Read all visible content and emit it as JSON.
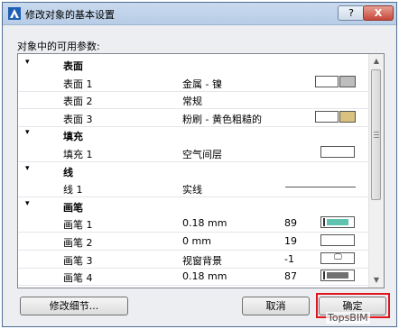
{
  "window": {
    "title": "修改对象的基本设置",
    "help_label": "?",
    "close_label": "X"
  },
  "list_label": "对象中的可用参数:",
  "rows": [
    {
      "kind": "header",
      "name": "表面"
    },
    {
      "kind": "item",
      "name": "表面 1",
      "value": "金属 - 镍",
      "swatch": "surface",
      "color": "#bdbdbd"
    },
    {
      "kind": "item",
      "name": "表面 2",
      "value": "常规"
    },
    {
      "kind": "item",
      "name": "表面 3",
      "value": "粉刷 - 黄色粗糙的",
      "swatch": "surface",
      "color": "#d9c17f"
    },
    {
      "kind": "header",
      "name": "填充"
    },
    {
      "kind": "item",
      "name": "填充 1",
      "value": "空气间层",
      "swatch": "fill"
    },
    {
      "kind": "header",
      "name": "线"
    },
    {
      "kind": "item",
      "name": "线 1",
      "value": "实线",
      "swatch": "line"
    },
    {
      "kind": "header",
      "name": "画笔"
    },
    {
      "kind": "item",
      "name": "画笔 1",
      "value": "0.18 mm",
      "num": "89",
      "swatch": "pen-teal"
    },
    {
      "kind": "item",
      "name": "画笔 2",
      "value": "0 mm",
      "num": "19",
      "swatch": "pen-empty"
    },
    {
      "kind": "item",
      "name": "画笔 3",
      "value": "视窗背景",
      "num": "-1",
      "swatch": "pen-monitor"
    },
    {
      "kind": "item",
      "name": "画笔 4",
      "value": "0.18 mm",
      "num": "87",
      "swatch": "pen-gray"
    }
  ],
  "buttons": {
    "detail": "修改细节...",
    "cancel": "取消",
    "ok": "确定"
  },
  "watermark": "TopsBIM",
  "colors": {
    "teal": "#5fc3b0",
    "gray_pen": "#707070",
    "red_highlight": "#e0151b"
  }
}
